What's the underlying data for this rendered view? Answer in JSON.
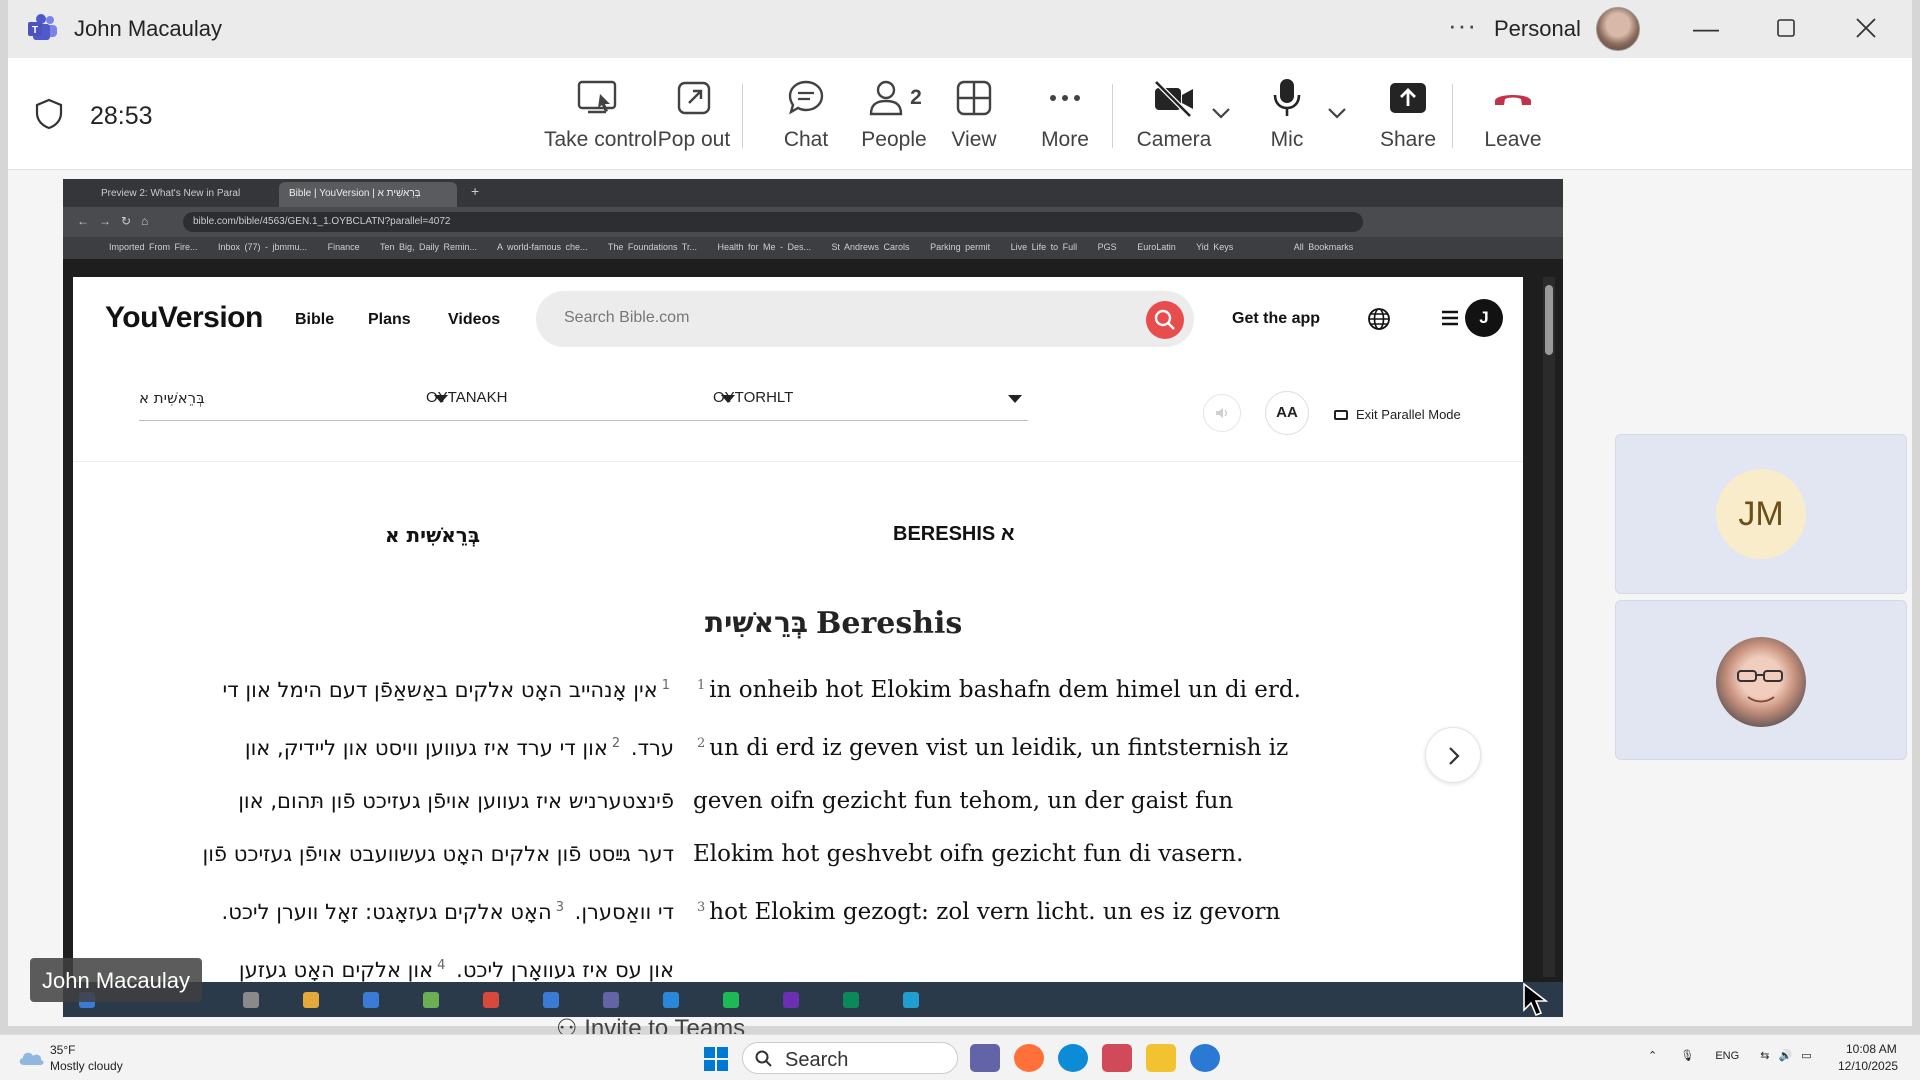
{
  "window": {
    "title": "John Macaulay",
    "account": "Personal"
  },
  "meeting": {
    "timer": "28:53",
    "toolbar": {
      "take_control": "Take control",
      "pop_out": "Pop out",
      "chat": "Chat",
      "people": "People",
      "people_count": "2",
      "view": "View",
      "more": "More",
      "camera": "Camera",
      "mic": "Mic",
      "share": "Share",
      "leave": "Leave"
    },
    "participants": [
      {
        "initials": "JM"
      },
      {
        "initials": ""
      }
    ],
    "presenter_tag": "John Macaulay",
    "invite_text": "Invite to Teams"
  },
  "browser": {
    "tabs": [
      "Preview 2: What's New in Paral",
      "Bible | YouVersion | בְּרֵאשִׁית א"
    ],
    "url": "bible.com/bible/4563/GEN.1_1.OYBCLATN?parallel=4072",
    "bookmarks": [
      "Imported From Fire...",
      "Inbox (77) - jbmmu...",
      "Finance",
      "Ten Big, Daily Remin...",
      "A world-famous che...",
      "The Foundations Tr...",
      "Health for Me - Des...",
      "St Andrews Carols",
      "Parking permit",
      "Live Life to Full",
      "PGS",
      "EuroLatin",
      "Yid Keys",
      "All Bookmarks"
    ]
  },
  "youversion": {
    "logo": "YouVersion",
    "nav": [
      "Bible",
      "Plans",
      "Videos"
    ],
    "search_placeholder": "Search Bible.com",
    "get_app": "Get the app",
    "avatar": "J",
    "selectors": [
      "בְּרֵאשִׁית א",
      "OYTANAKH",
      "OYTORHLT"
    ],
    "aa": "AA",
    "exit_parallel": "Exit Parallel Mode",
    "col_left_title": "בְּרֵאשִׁית א",
    "col_right_title": "BERESHIS א",
    "chapter_heading_he": "בְּרֵאשִׁית",
    "chapter_heading_en": "Bereshis",
    "verses_he": [
      {
        "num": "1",
        "text": "אין אָנהייב האָט אלקים באַשאַפֿן דעם הימל און די ערד."
      },
      {
        "num": "2",
        "text": "און די ערד איז געווען וויסט און ליידיק, און פֿינצטערניש איז געווען אויפֿן געזיכט פֿון תּהום, און דער גײַסט פֿון אלקים האָט געשוועבט אויפֿן געזיכט פֿון די וואַסערן."
      },
      {
        "num": "3",
        "text": "האָט אלקים געזאָגט: זאָל ווערן ליכט. און עס איז געוואָרן ליכט."
      },
      {
        "num": "4",
        "text": "און אלקים האָט געזען דאָס ליכט אַז עס איז גוט; און"
      }
    ],
    "verses_en": [
      {
        "num": "1",
        "text": "in onheib hot Elokim bashafn dem himel un di erd."
      },
      {
        "num": "2",
        "text": "un di erd iz geven vist un leidik, un fintsternish iz geven oifn gezicht fun tehom, un der gaist fun Elokim hot geshvebt oifn gezicht fun di vasern."
      },
      {
        "num": "3",
        "text": "hot Elokim gezogt: zol vern licht. un es iz gevorn"
      }
    ]
  },
  "taskbar": {
    "weather_temp": "35°F",
    "weather_desc": "Mostly cloudy",
    "search": "Search",
    "lang": "ENG",
    "time": "10:08 AM",
    "date": "12/10/2025"
  }
}
